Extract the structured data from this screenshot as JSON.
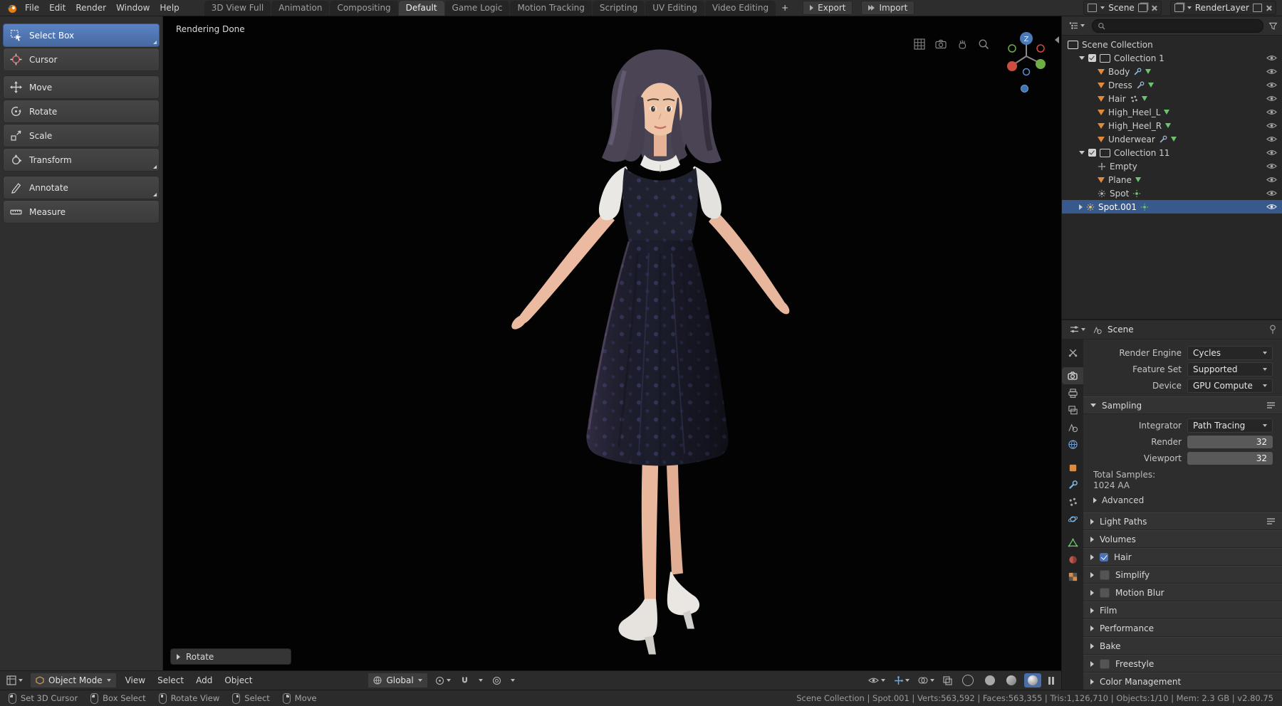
{
  "topbar": {
    "menus": [
      "File",
      "Edit",
      "Render",
      "Window",
      "Help"
    ],
    "tabs": [
      "3D View Full",
      "Animation",
      "Compositing",
      "Default",
      "Game Logic",
      "Motion Tracking",
      "Scripting",
      "UV Editing",
      "Video Editing"
    ],
    "active_tab": "Default",
    "add_tab": "+",
    "export_button": "Export",
    "import_button": "Import",
    "scene_selector": "Scene",
    "renderlayer_selector": "RenderLayer"
  },
  "toolbar": {
    "active_tool": "Select Box",
    "tools": [
      {
        "label": "Select Box"
      },
      {
        "label": "Cursor"
      },
      {
        "label": "Move"
      },
      {
        "label": "Rotate"
      },
      {
        "label": "Scale"
      },
      {
        "label": "Transform"
      },
      {
        "label": "Annotate"
      },
      {
        "label": "Measure"
      }
    ]
  },
  "viewport": {
    "render_status": "Rendering Done",
    "operator_panel_label": "Rotate",
    "gizmo_axis_label": "Z",
    "header": {
      "mode_selector": "Object Mode",
      "menus": [
        "View",
        "Select",
        "Add",
        "Object"
      ],
      "orientation_selector": "Global"
    }
  },
  "outliner": {
    "search_placeholder": "",
    "rows": [
      {
        "label": "Scene Collection",
        "type": "scene-collection"
      },
      {
        "label": "Collection 1",
        "type": "collection"
      },
      {
        "label": "Body",
        "type": "mesh"
      },
      {
        "label": "Dress",
        "type": "mesh"
      },
      {
        "label": "Hair",
        "type": "mesh"
      },
      {
        "label": "High_Heel_L",
        "type": "mesh"
      },
      {
        "label": "High_Heel_R",
        "type": "mesh"
      },
      {
        "label": "Underwear",
        "type": "mesh"
      },
      {
        "label": "Collection 11",
        "type": "collection"
      },
      {
        "label": "Empty",
        "type": "empty"
      },
      {
        "label": "Plane",
        "type": "mesh"
      },
      {
        "label": "Spot",
        "type": "light"
      },
      {
        "label": "Spot.001",
        "type": "light",
        "selected": true
      }
    ]
  },
  "properties": {
    "breadcrumb": "Scene",
    "engine": {
      "label": "Render Engine",
      "value": "Cycles"
    },
    "feature_set": {
      "label": "Feature Set",
      "value": "Supported"
    },
    "device": {
      "label": "Device",
      "value": "GPU Compute"
    },
    "sampling": {
      "title": "Sampling",
      "integrator_label": "Integrator",
      "integrator_value": "Path Tracing",
      "render_label": "Render",
      "render_value": "32",
      "viewport_label": "Viewport",
      "viewport_value": "32",
      "total_samples_label": "Total Samples:",
      "total_samples_value": "1024 AA",
      "advanced_label": "Advanced"
    },
    "sections": [
      {
        "title": "Light Paths"
      },
      {
        "title": "Volumes"
      },
      {
        "title": "Hair",
        "checkbox": "checked"
      },
      {
        "title": "Simplify",
        "checkbox": "unchecked"
      },
      {
        "title": "Motion Blur",
        "checkbox": "unchecked"
      },
      {
        "title": "Film"
      },
      {
        "title": "Performance"
      },
      {
        "title": "Bake"
      },
      {
        "title": "Freestyle",
        "checkbox": "unchecked"
      },
      {
        "title": "Color Management"
      }
    ]
  },
  "statusbar": {
    "hints": [
      {
        "label": "Set 3D Cursor"
      },
      {
        "label": "Box Select"
      },
      {
        "label": "Rotate View"
      },
      {
        "label": "Select"
      },
      {
        "label": "Move"
      }
    ],
    "info": "Scene Collection | Spot.001 | Verts:563,592 | Faces:563,355 | Tris:1,126,710 | Objects:1/10 | Mem: 2.3 GB | v2.80.75"
  }
}
